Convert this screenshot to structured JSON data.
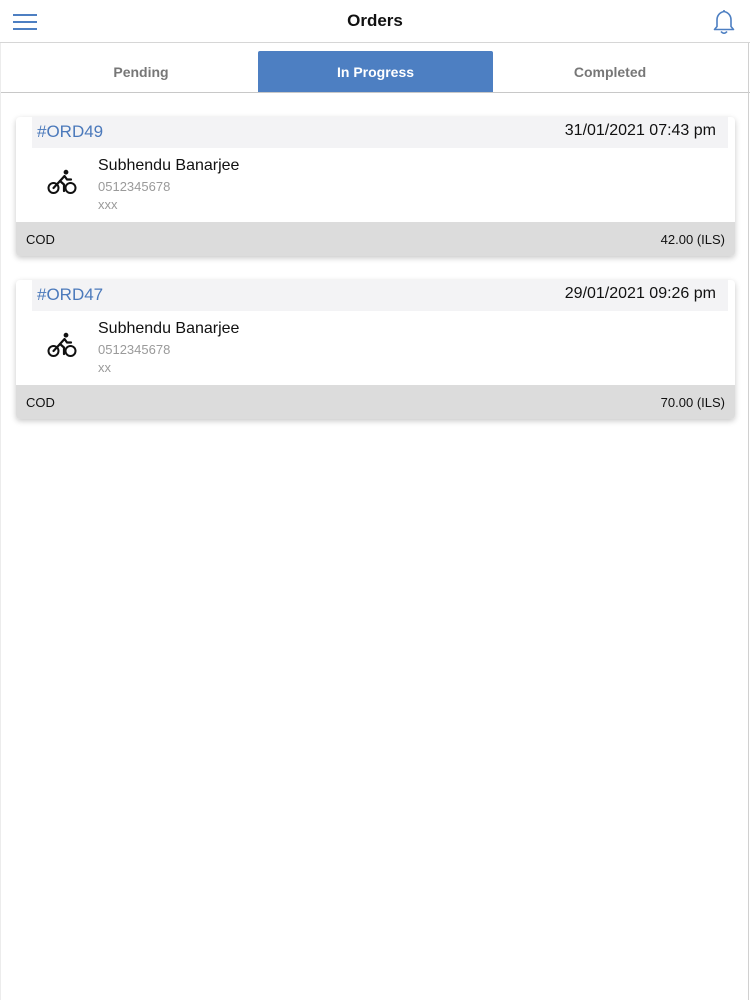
{
  "header": {
    "title": "Orders",
    "menu_icon": "hamburger-menu-icon",
    "bell_icon": "bell-icon",
    "accent_color": "#4d7fc2"
  },
  "tabs": [
    {
      "label": "Pending",
      "active": false
    },
    {
      "label": "In Progress",
      "active": true
    },
    {
      "label": "Completed",
      "active": false
    }
  ],
  "orders": [
    {
      "id": "#ORD49",
      "datetime": "31/01/2021 07:43 pm",
      "customer_name": "Subhendu Banarjee",
      "phone": "0512345678",
      "note": "xxx",
      "payment_method": "COD",
      "amount": "42.00 (ILS)",
      "icon": "bicycle-icon"
    },
    {
      "id": "#ORD47",
      "datetime": "29/01/2021 09:26 pm",
      "customer_name": "Subhendu Banarjee",
      "phone": "0512345678",
      "note": "xx",
      "payment_method": "COD",
      "amount": "70.00 (ILS)",
      "icon": "bicycle-icon"
    }
  ]
}
